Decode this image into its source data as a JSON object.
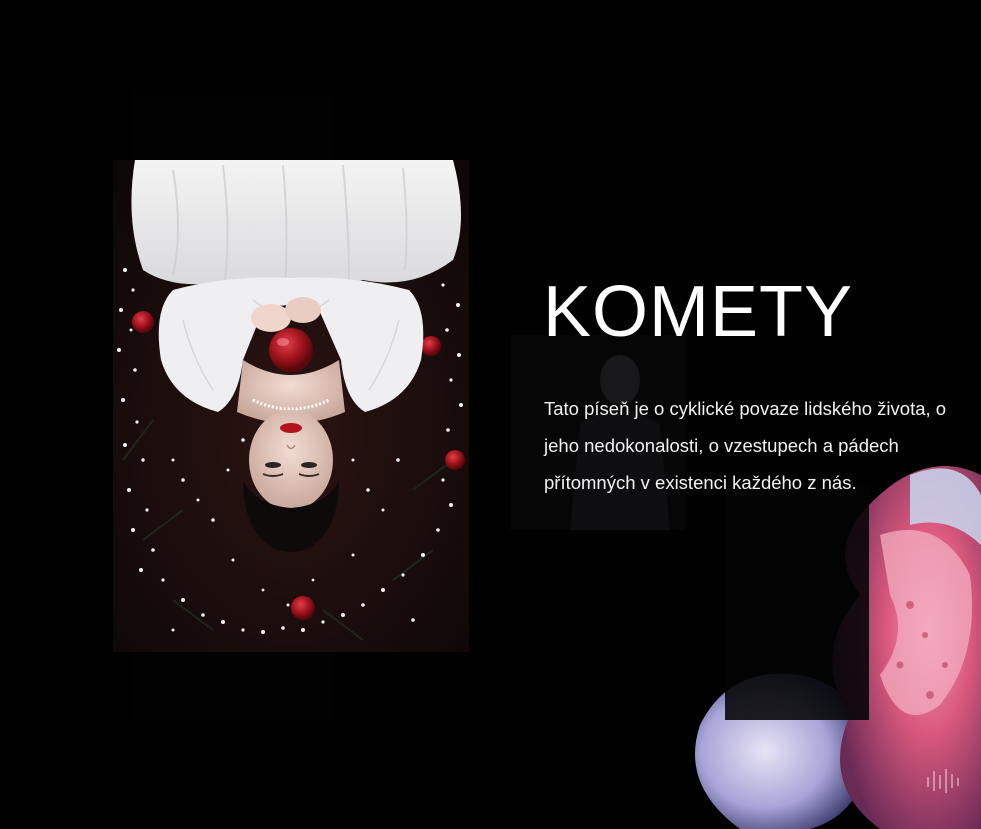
{
  "section": {
    "title": "KOMETY",
    "description": "Tato píseň je o cyklické povaze lidského života, o jeho nedokonalosti, o vzestupech a pádech přítomných v existenci každého z nás."
  },
  "images": {
    "main_photo": "woman-in-white-dress-with-apple",
    "decoration": "pink-rose",
    "background_figure": "faded-figure"
  },
  "colors": {
    "background": "#010102",
    "text": "#ffffff",
    "accent_red": "#b3121f",
    "rose_pink": "#e76a8a"
  }
}
